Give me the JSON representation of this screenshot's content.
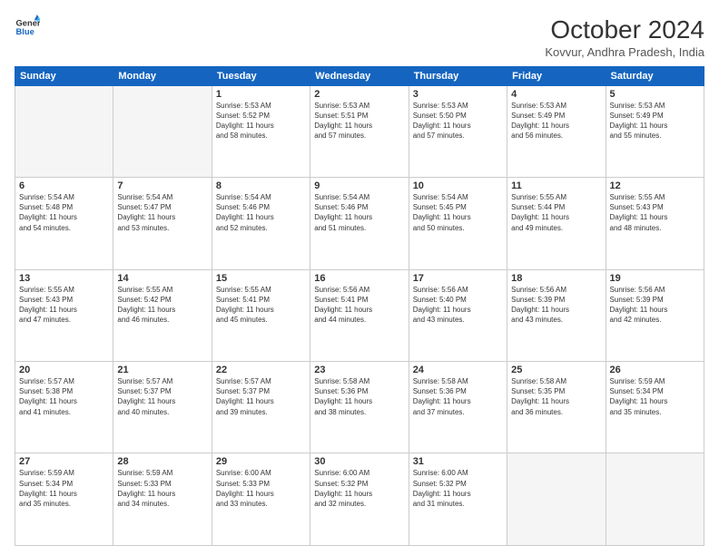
{
  "logo": {
    "line1": "General",
    "line2": "Blue"
  },
  "title": "October 2024",
  "subtitle": "Kovvur, Andhra Pradesh, India",
  "headers": [
    "Sunday",
    "Monday",
    "Tuesday",
    "Wednesday",
    "Thursday",
    "Friday",
    "Saturday"
  ],
  "weeks": [
    [
      {
        "day": "",
        "info": ""
      },
      {
        "day": "",
        "info": ""
      },
      {
        "day": "1",
        "info": "Sunrise: 5:53 AM\nSunset: 5:52 PM\nDaylight: 11 hours\nand 58 minutes."
      },
      {
        "day": "2",
        "info": "Sunrise: 5:53 AM\nSunset: 5:51 PM\nDaylight: 11 hours\nand 57 minutes."
      },
      {
        "day": "3",
        "info": "Sunrise: 5:53 AM\nSunset: 5:50 PM\nDaylight: 11 hours\nand 57 minutes."
      },
      {
        "day": "4",
        "info": "Sunrise: 5:53 AM\nSunset: 5:49 PM\nDaylight: 11 hours\nand 56 minutes."
      },
      {
        "day": "5",
        "info": "Sunrise: 5:53 AM\nSunset: 5:49 PM\nDaylight: 11 hours\nand 55 minutes."
      }
    ],
    [
      {
        "day": "6",
        "info": "Sunrise: 5:54 AM\nSunset: 5:48 PM\nDaylight: 11 hours\nand 54 minutes."
      },
      {
        "day": "7",
        "info": "Sunrise: 5:54 AM\nSunset: 5:47 PM\nDaylight: 11 hours\nand 53 minutes."
      },
      {
        "day": "8",
        "info": "Sunrise: 5:54 AM\nSunset: 5:46 PM\nDaylight: 11 hours\nand 52 minutes."
      },
      {
        "day": "9",
        "info": "Sunrise: 5:54 AM\nSunset: 5:46 PM\nDaylight: 11 hours\nand 51 minutes."
      },
      {
        "day": "10",
        "info": "Sunrise: 5:54 AM\nSunset: 5:45 PM\nDaylight: 11 hours\nand 50 minutes."
      },
      {
        "day": "11",
        "info": "Sunrise: 5:55 AM\nSunset: 5:44 PM\nDaylight: 11 hours\nand 49 minutes."
      },
      {
        "day": "12",
        "info": "Sunrise: 5:55 AM\nSunset: 5:43 PM\nDaylight: 11 hours\nand 48 minutes."
      }
    ],
    [
      {
        "day": "13",
        "info": "Sunrise: 5:55 AM\nSunset: 5:43 PM\nDaylight: 11 hours\nand 47 minutes."
      },
      {
        "day": "14",
        "info": "Sunrise: 5:55 AM\nSunset: 5:42 PM\nDaylight: 11 hours\nand 46 minutes."
      },
      {
        "day": "15",
        "info": "Sunrise: 5:55 AM\nSunset: 5:41 PM\nDaylight: 11 hours\nand 45 minutes."
      },
      {
        "day": "16",
        "info": "Sunrise: 5:56 AM\nSunset: 5:41 PM\nDaylight: 11 hours\nand 44 minutes."
      },
      {
        "day": "17",
        "info": "Sunrise: 5:56 AM\nSunset: 5:40 PM\nDaylight: 11 hours\nand 43 minutes."
      },
      {
        "day": "18",
        "info": "Sunrise: 5:56 AM\nSunset: 5:39 PM\nDaylight: 11 hours\nand 43 minutes."
      },
      {
        "day": "19",
        "info": "Sunrise: 5:56 AM\nSunset: 5:39 PM\nDaylight: 11 hours\nand 42 minutes."
      }
    ],
    [
      {
        "day": "20",
        "info": "Sunrise: 5:57 AM\nSunset: 5:38 PM\nDaylight: 11 hours\nand 41 minutes."
      },
      {
        "day": "21",
        "info": "Sunrise: 5:57 AM\nSunset: 5:37 PM\nDaylight: 11 hours\nand 40 minutes."
      },
      {
        "day": "22",
        "info": "Sunrise: 5:57 AM\nSunset: 5:37 PM\nDaylight: 11 hours\nand 39 minutes."
      },
      {
        "day": "23",
        "info": "Sunrise: 5:58 AM\nSunset: 5:36 PM\nDaylight: 11 hours\nand 38 minutes."
      },
      {
        "day": "24",
        "info": "Sunrise: 5:58 AM\nSunset: 5:36 PM\nDaylight: 11 hours\nand 37 minutes."
      },
      {
        "day": "25",
        "info": "Sunrise: 5:58 AM\nSunset: 5:35 PM\nDaylight: 11 hours\nand 36 minutes."
      },
      {
        "day": "26",
        "info": "Sunrise: 5:59 AM\nSunset: 5:34 PM\nDaylight: 11 hours\nand 35 minutes."
      }
    ],
    [
      {
        "day": "27",
        "info": "Sunrise: 5:59 AM\nSunset: 5:34 PM\nDaylight: 11 hours\nand 35 minutes."
      },
      {
        "day": "28",
        "info": "Sunrise: 5:59 AM\nSunset: 5:33 PM\nDaylight: 11 hours\nand 34 minutes."
      },
      {
        "day": "29",
        "info": "Sunrise: 6:00 AM\nSunset: 5:33 PM\nDaylight: 11 hours\nand 33 minutes."
      },
      {
        "day": "30",
        "info": "Sunrise: 6:00 AM\nSunset: 5:32 PM\nDaylight: 11 hours\nand 32 minutes."
      },
      {
        "day": "31",
        "info": "Sunrise: 6:00 AM\nSunset: 5:32 PM\nDaylight: 11 hours\nand 31 minutes."
      },
      {
        "day": "",
        "info": ""
      },
      {
        "day": "",
        "info": ""
      }
    ]
  ]
}
